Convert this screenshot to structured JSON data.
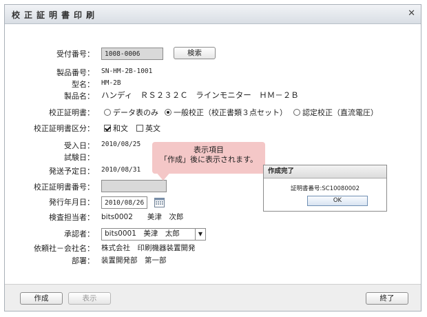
{
  "dialog": {
    "title": "校正証明書印刷",
    "close_icon": "close-icon"
  },
  "labels": {
    "reception_no": "受付番号：",
    "product_no": "製品番号：",
    "model": "型名：",
    "product_name": "製品名：",
    "cert_type": "校正証明書：",
    "cert_lang": "校正証明書区分：",
    "received": "受入日：",
    "tested": "試験日：",
    "ship_date": "発送予定日：",
    "cert_no": "校正証明書番号：",
    "issue_date": "発行年月日：",
    "inspector": "検査担当者：",
    "approver": "承認者：",
    "client_company": "依頼社－会社名：",
    "department": "部署："
  },
  "values": {
    "reception_no": "1008-0006",
    "product_no": "SN-HM-2B-1001",
    "model": "HM-2B",
    "product_name": "ハンディ　ＲＳ２３２Ｃ　ラインモニター　ＨＭ－２Ｂ",
    "received": "2010/08/25",
    "tested": "",
    "ship_date": "2010/08/31",
    "cert_no": "",
    "issue_date": "2010/08/26",
    "inspector": "bits0002　　美津　次郎",
    "approver": "bits0001　美津　太郎",
    "client_company": "株式会社　印刷機器装置開発",
    "department": "装置開発部　第一部"
  },
  "buttons": {
    "search": "検索",
    "create": "作成",
    "display": "表示",
    "exit": "終了"
  },
  "cert_type_options": [
    {
      "label": "データ表のみ",
      "selected": false
    },
    {
      "label": "一般校正（校正書類３点セット）",
      "selected": true
    },
    {
      "label": "認定校正（直流電圧）",
      "selected": false
    }
  ],
  "cert_lang_options": [
    {
      "label": "和文",
      "checked": true
    },
    {
      "label": "英文",
      "checked": false
    }
  ],
  "tooltip": {
    "line1": "表示項目",
    "line2": "「作成」後に表示されます。"
  },
  "popup": {
    "title": "作成完了",
    "message": "証明書番号:SC10080002",
    "ok": "OK"
  },
  "colors": {
    "tooltip_bg": "#f4c7c7",
    "footer_bg": "#eeeeee",
    "titlebar_bg": "#d9dee4"
  }
}
